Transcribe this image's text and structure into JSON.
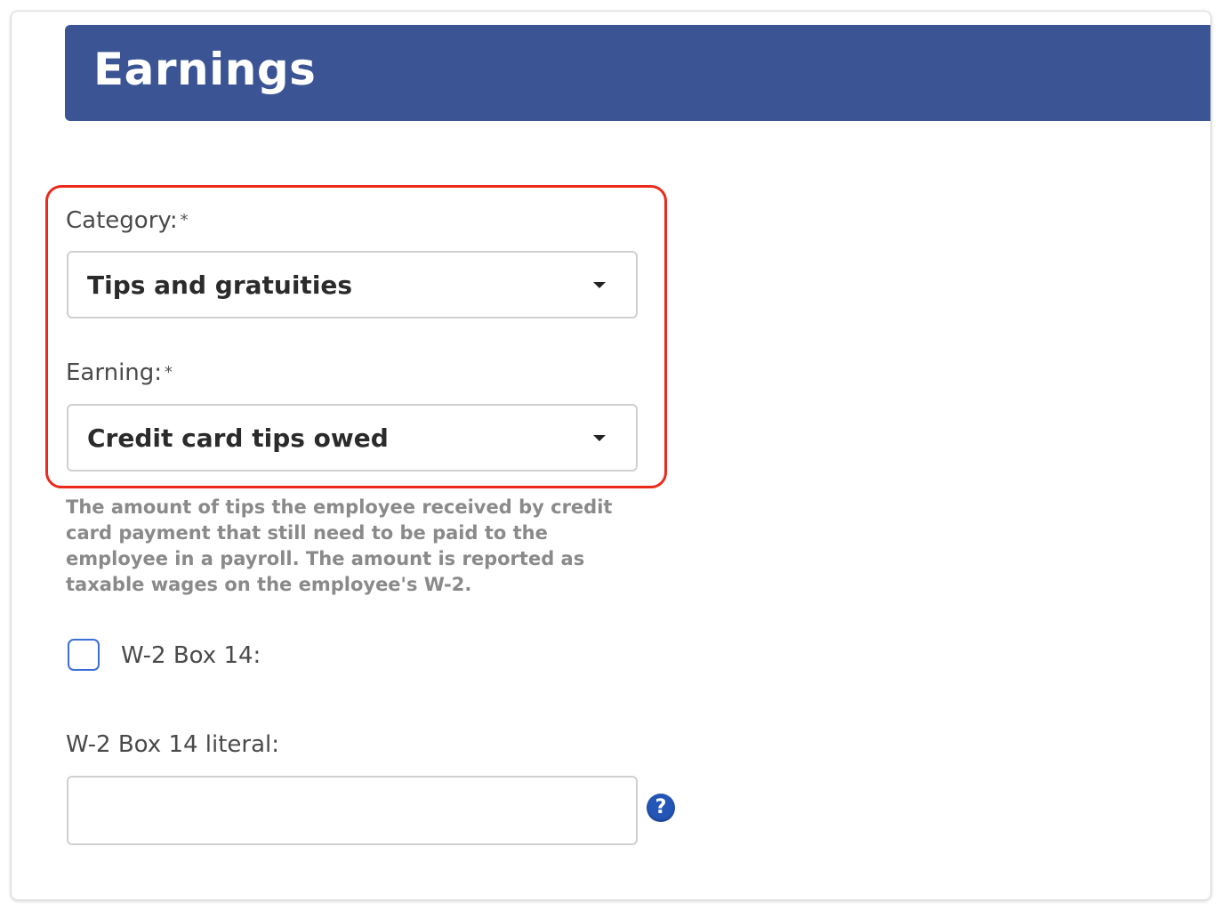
{
  "header": {
    "title": "Earnings"
  },
  "form": {
    "category": {
      "label": "Category:",
      "required_mark": "*",
      "selected": "Tips and gratuities"
    },
    "earning": {
      "label": "Earning:",
      "required_mark": "*",
      "selected": "Credit card tips owed",
      "description": "The amount of tips the employee received by credit card payment that still need to be paid to the employee in a payroll. The amount is reported as taxable wages on the employee's W-2."
    },
    "w2_box14": {
      "label": "W-2 Box 14:",
      "checked": false
    },
    "w2_box14_literal": {
      "label": "W-2 Box 14 literal:",
      "value": "",
      "help_icon_glyph": "?"
    }
  },
  "icons": {
    "dropdown": "caret-down-icon",
    "help": "question-circle-icon"
  },
  "colors": {
    "header_bg": "#3b5494",
    "highlight_border": "#ec2a1c",
    "checkbox_border": "#3c6fd6",
    "help_icon_bg": "#2456b8"
  }
}
